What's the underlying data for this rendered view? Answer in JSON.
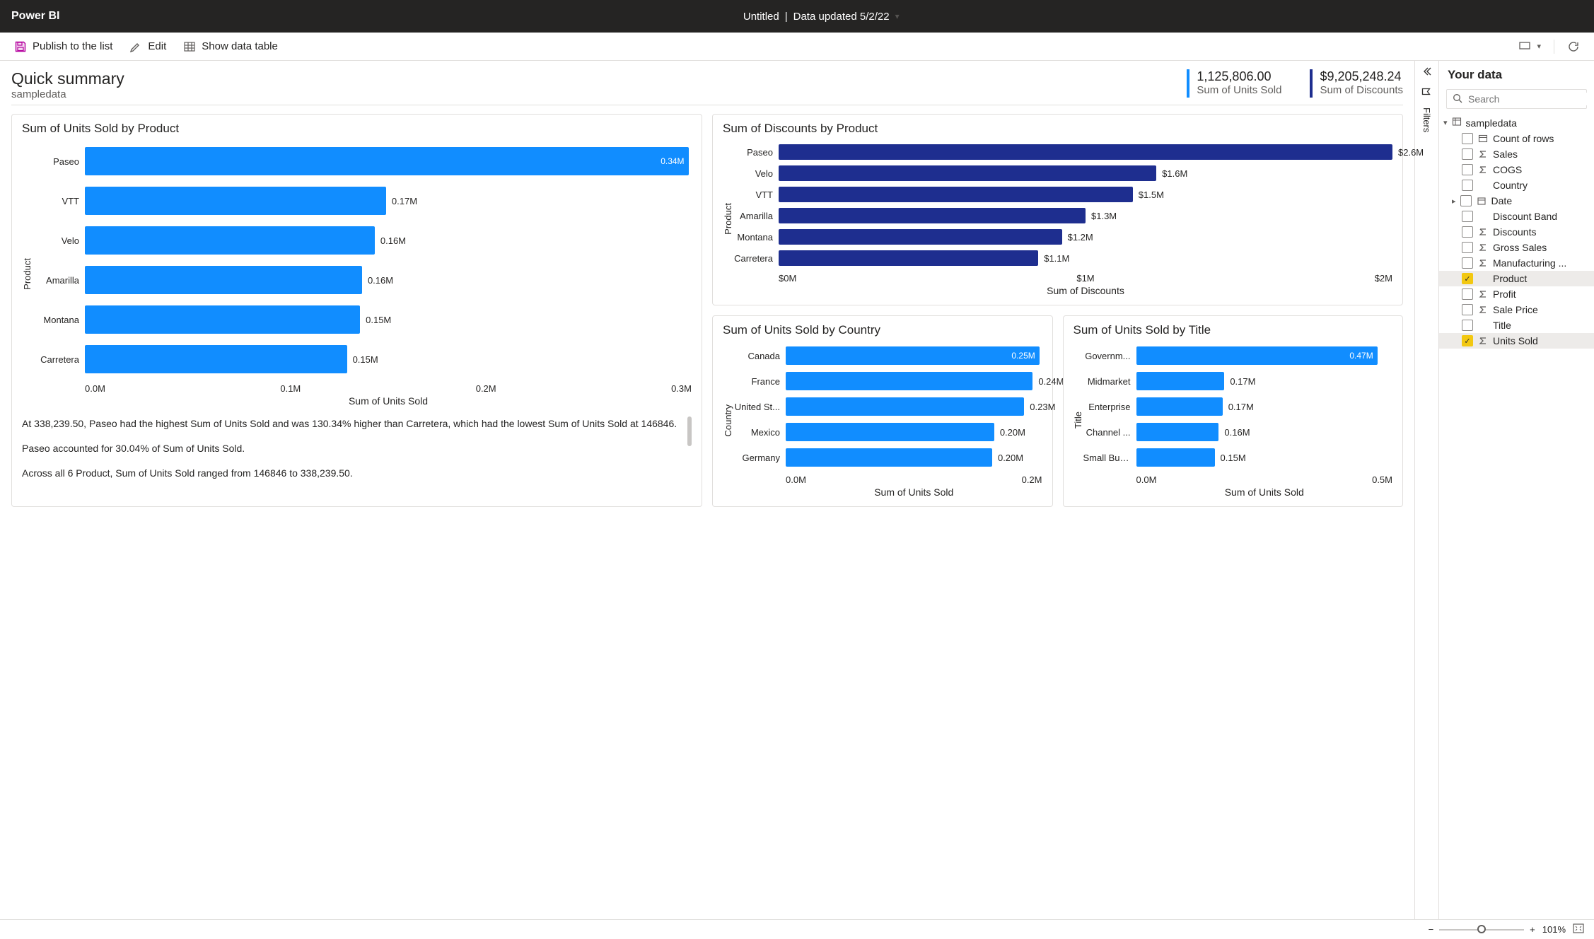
{
  "header": {
    "brand": "Power BI",
    "doc_title": "Untitled",
    "data_updated": "Data updated 5/2/22"
  },
  "toolbar": {
    "publish": "Publish to the list",
    "edit": "Edit",
    "show_data": "Show data table"
  },
  "summary": {
    "title": "Quick summary",
    "subtitle": "sampledata",
    "kpis": [
      {
        "value": "1,125,806.00",
        "label": "Sum of Units Sold",
        "color": "blue"
      },
      {
        "value": "$9,205,248.24",
        "label": "Sum of Discounts",
        "color": "dark"
      }
    ]
  },
  "insights": [
    "At 338,239.50, Paseo had the highest Sum of Units Sold and was 130.34% higher than Carretera, which had the lowest Sum of Units Sold at 146846.",
    "Paseo accounted for 30.04% of Sum of Units Sold.",
    "Across all 6 Product, Sum of Units Sold ranged from 146846 to 338,239.50."
  ],
  "chart_data": [
    {
      "id": "chart1",
      "type": "bar",
      "orientation": "horizontal",
      "title": "Sum of Units Sold by Product",
      "xlabel": "Sum of Units Sold",
      "ylabel": "Product",
      "x_ticks": [
        "0.0M",
        "0.1M",
        "0.2M",
        "0.3M"
      ],
      "x_max": 340000,
      "color": "#118DFF",
      "categories": [
        "Paseo",
        "VTT",
        "Velo",
        "Amarilla",
        "Montana",
        "Carretera"
      ],
      "values": [
        338240,
        168784,
        162425,
        155316,
        154199,
        146846
      ],
      "labels": [
        "0.34M",
        "0.17M",
        "0.16M",
        "0.16M",
        "0.15M",
        "0.15M"
      ],
      "label_inside": [
        true,
        false,
        false,
        false,
        false,
        false
      ]
    },
    {
      "id": "chart2",
      "type": "bar",
      "orientation": "horizontal",
      "title": "Sum of Discounts by Product",
      "xlabel": "Sum of Discounts",
      "ylabel": "Product",
      "x_ticks": [
        "$0M",
        "$1M",
        "$2M"
      ],
      "x_max": 2600000,
      "color": "#1E2E8F",
      "categories": [
        "Paseo",
        "Velo",
        "VTT",
        "Amarilla",
        "Montana",
        "Carretera"
      ],
      "values": [
        2600000,
        1600000,
        1500000,
        1300000,
        1200000,
        1100000
      ],
      "labels": [
        "$2.6M",
        "$1.6M",
        "$1.5M",
        "$1.3M",
        "$1.2M",
        "$1.1M"
      ],
      "label_inside": [
        false,
        false,
        false,
        false,
        false,
        false
      ]
    },
    {
      "id": "chart3",
      "type": "bar",
      "orientation": "horizontal",
      "title": "Sum of Units Sold by Country",
      "xlabel": "Sum of Units Sold",
      "ylabel": "Country",
      "x_ticks": [
        "0.0M",
        "0.2M"
      ],
      "x_max": 250000,
      "color": "#118DFF",
      "categories": [
        "Canada",
        "France",
        "United St...",
        "Mexico",
        "Germany"
      ],
      "values": [
        247429,
        240932,
        232628,
        203325,
        201367
      ],
      "labels": [
        "0.25M",
        "0.24M",
        "0.23M",
        "0.20M",
        "0.20M"
      ],
      "label_inside": [
        true,
        false,
        false,
        false,
        false
      ]
    },
    {
      "id": "chart4",
      "type": "bar",
      "orientation": "horizontal",
      "title": "Sum of Units Sold by Title",
      "xlabel": "Sum of Units Sold",
      "ylabel": "Title",
      "x_ticks": [
        "0.0M",
        "0.5M"
      ],
      "x_max": 500000,
      "color": "#118DFF",
      "categories": [
        "Governm...",
        "Midmarket",
        "Enterprise",
        "Channel ...",
        "Small Bus..."
      ],
      "values": [
        470673,
        172178,
        168552,
        161263,
        153140
      ],
      "labels": [
        "0.47M",
        "0.17M",
        "0.17M",
        "0.16M",
        "0.15M"
      ],
      "label_inside": [
        true,
        false,
        false,
        false,
        false
      ]
    }
  ],
  "filters_label": "Filters",
  "data_pane": {
    "title": "Your data",
    "search_placeholder": "Search",
    "table": "sampledata",
    "fields": [
      {
        "label": "Count of rows",
        "icon": "table",
        "checked": false
      },
      {
        "label": "Sales",
        "icon": "sigma",
        "checked": false
      },
      {
        "label": "COGS",
        "icon": "sigma",
        "checked": false
      },
      {
        "label": "Country",
        "icon": "",
        "checked": false
      },
      {
        "label": "Date",
        "icon": "calendar",
        "checked": false,
        "expandable": true
      },
      {
        "label": "Discount Band",
        "icon": "",
        "checked": false
      },
      {
        "label": "Discounts",
        "icon": "sigma",
        "checked": false
      },
      {
        "label": "Gross Sales",
        "icon": "sigma",
        "checked": false
      },
      {
        "label": "Manufacturing ...",
        "icon": "sigma",
        "checked": false
      },
      {
        "label": "Product",
        "icon": "",
        "checked": true,
        "selected": true
      },
      {
        "label": "Profit",
        "icon": "sigma",
        "checked": false
      },
      {
        "label": "Sale Price",
        "icon": "sigma",
        "checked": false
      },
      {
        "label": "Title",
        "icon": "",
        "checked": false
      },
      {
        "label": "Units Sold",
        "icon": "sigma",
        "checked": true,
        "selected": true
      }
    ]
  },
  "footer": {
    "zoom": "101%"
  }
}
